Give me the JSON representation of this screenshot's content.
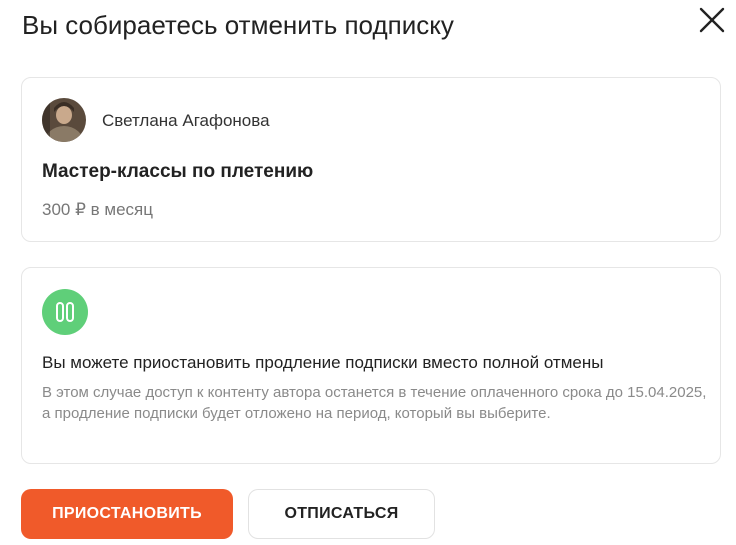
{
  "dialog": {
    "title": "Вы собираетесь отменить подписку",
    "close_icon": "close-icon"
  },
  "subscription": {
    "author_name": "Светлана Агафонова",
    "title": "Мастер-классы по плетению",
    "price": "300 ₽ в месяц"
  },
  "pause_offer": {
    "icon": "pause-icon",
    "icon_color": "#5fcf79",
    "title": "Вы можете приостановить продление подписки вместо полной отмены",
    "description": "В этом случае доступ к контенту автора останется в течение оплаченного срока до 15.04.2025, а продление подписки будет отложено на период, который вы выберите."
  },
  "actions": {
    "pause_label": "ПРИОСТАНОВИТЬ",
    "unsubscribe_label": "ОТПИСАТЬСЯ",
    "primary_color": "#f05a2a"
  }
}
